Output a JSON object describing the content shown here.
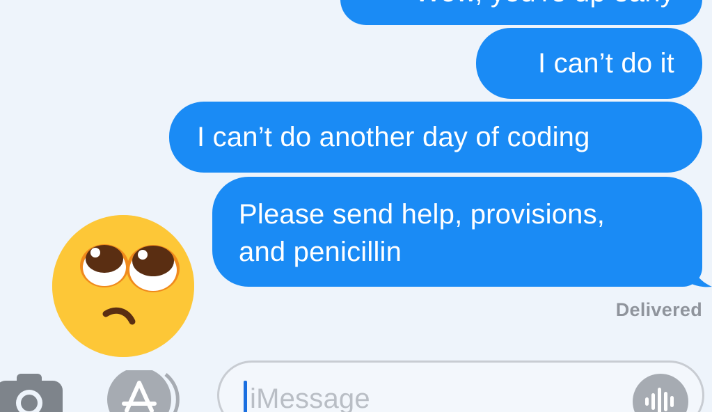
{
  "messages": [
    {
      "text": "Wow, you're up early"
    },
    {
      "text": "I can’t do it"
    },
    {
      "text": "I can’t do another day of coding"
    },
    {
      "text": "Please send help, provisions,\nand penicillin"
    }
  ],
  "status": {
    "delivered": "Delivered"
  },
  "reaction": {
    "icon": "pleading-face-emoji-icon"
  },
  "compose": {
    "placeholder": "iMessage",
    "camera_icon": "camera-icon",
    "apps_icon": "app-store-icon",
    "audio_icon": "audio-waveform-icon"
  },
  "colors": {
    "sent_bubble": "#1a8bf5",
    "background": "#eef4fb",
    "status_text": "#8f949c",
    "caret": "#1a6fe0"
  }
}
